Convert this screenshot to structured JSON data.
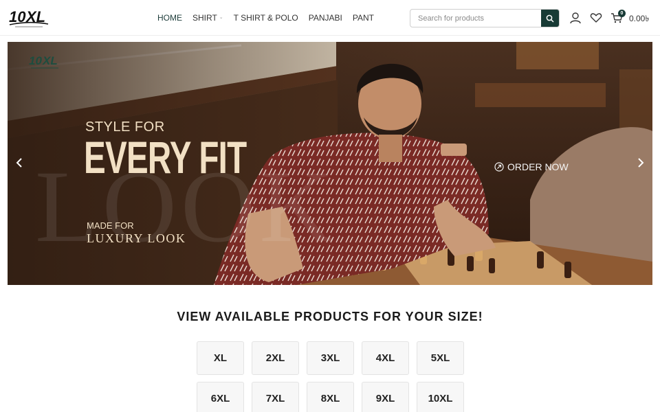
{
  "header": {
    "logo_alt": "10XL",
    "nav": [
      {
        "label": "HOME",
        "active": true,
        "has_dropdown": false
      },
      {
        "label": "SHIRT",
        "active": false,
        "has_dropdown": true
      },
      {
        "label": "T SHIRT & POLO",
        "active": false,
        "has_dropdown": false
      },
      {
        "label": "PANJABI",
        "active": false,
        "has_dropdown": false
      },
      {
        "label": "PANT",
        "active": false,
        "has_dropdown": false
      }
    ],
    "search": {
      "placeholder": "Search for products",
      "value": ""
    },
    "icons": [
      "search-icon",
      "user-icon",
      "heart-icon",
      "cart-icon"
    ],
    "cart": {
      "count": "0",
      "amount": "0.00৳"
    }
  },
  "banner": {
    "line1": "STYLE FOR",
    "line2": "EVERY FIT",
    "line3": "MADE FOR",
    "line4": "LUXURY LOOK",
    "watermark": "LOOK",
    "cta": "ORDER NOW",
    "prev_icon": "chevron-left-icon",
    "next_icon": "chevron-right-icon"
  },
  "sizes": {
    "heading": "VIEW AVAILABLE PRODUCTS FOR YOUR SIZE!",
    "items": [
      "XL",
      "2XL",
      "3XL",
      "4XL",
      "5XL",
      "6XL",
      "7XL",
      "8XL",
      "9XL",
      "10XL"
    ]
  },
  "colors": {
    "brand": "#173a35",
    "banner_text": "#f2e0c4",
    "shirt": "#7a2a25"
  }
}
